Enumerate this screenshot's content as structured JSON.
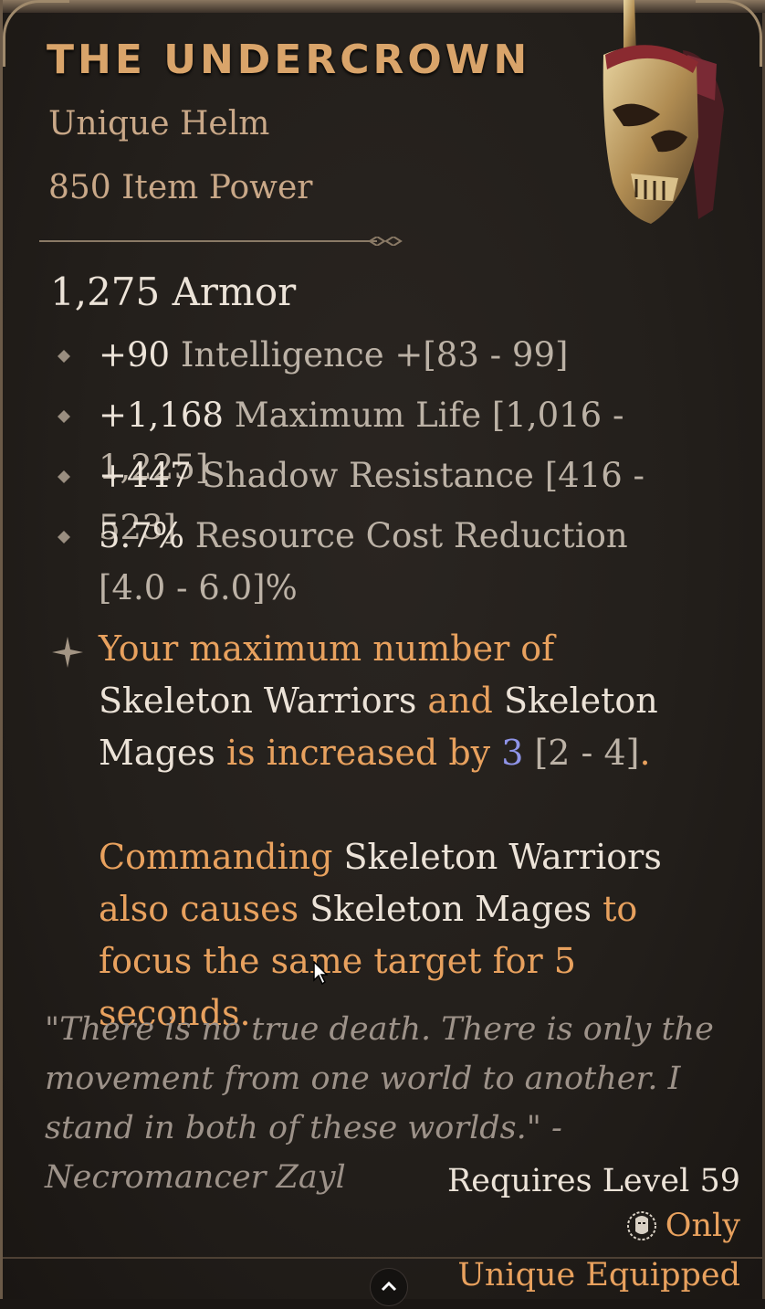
{
  "item": {
    "name": "THE UNDERCROWN",
    "type": "Unique Helm",
    "power": "850 Item Power",
    "armor": "1,275 Armor"
  },
  "affixes": [
    {
      "value": "+90",
      "text": " Intelligence +[83 - 99]"
    },
    {
      "value": "+1,168",
      "text": " Maximum Life [1,016 - 1,225]"
    },
    {
      "value": "+447",
      "text": " Shadow Resistance [416 - 523]"
    },
    {
      "value": "5.7%",
      "text": " Resource Cost Reduction [4.0 - 6.0]%"
    }
  ],
  "aspect": {
    "p1": {
      "t1": "Your maximum number of ",
      "k1": "Skeleton Warriors",
      "t2": " and ",
      "k2": "Skeleton Mages",
      "t3": " is increased by ",
      "val": "3",
      "range": " [2 - 4]",
      "t4": "."
    },
    "p2": {
      "t1": "Commanding ",
      "k1": "Skeleton Warriors",
      "t2": " also causes ",
      "k2": "Skeleton Mages",
      "t3": " to focus the same target for 5 seconds."
    }
  },
  "flavor": "\"There is no true death. There is only the movement from one world to another. I stand in both of these worlds.\" -Necromancer Zayl",
  "requirements": {
    "level": "Requires Level 59",
    "class_only": "Only",
    "unique": "Unique Equipped"
  },
  "colors": {
    "unique_orange": "#e8a15e",
    "value_white": "#ece3d8",
    "highlight_blue": "#8f94e8"
  }
}
